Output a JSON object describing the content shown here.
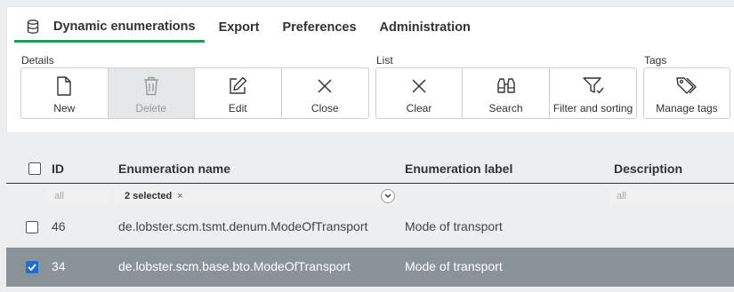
{
  "tabs": [
    {
      "label": "Dynamic enumerations",
      "active": true,
      "icon": "database-icon"
    },
    {
      "label": "Export"
    },
    {
      "label": "Preferences"
    },
    {
      "label": "Administration"
    }
  ],
  "toolbar": {
    "details": {
      "label": "Details",
      "buttons": [
        {
          "label": "New",
          "icon": "file-icon"
        },
        {
          "label": "Delete",
          "icon": "trash-icon",
          "disabled": true
        },
        {
          "label": "Edit",
          "icon": "edit-icon"
        },
        {
          "label": "Close",
          "icon": "close-icon"
        }
      ]
    },
    "list": {
      "label": "List",
      "buttons": [
        {
          "label": "Clear",
          "icon": "close-icon"
        },
        {
          "label": "Search",
          "icon": "binoculars-icon"
        },
        {
          "label": "Filter and sorting",
          "icon": "filter-icon"
        }
      ]
    },
    "tags": {
      "label": "Tags",
      "buttons": [
        {
          "label": "Manage tags",
          "icon": "tags-icon"
        }
      ]
    }
  },
  "table": {
    "columns": [
      "ID",
      "Enumeration name",
      "Enumeration label",
      "Description"
    ],
    "filters": {
      "id_placeholder": "all",
      "name_chip": "2 selected",
      "name_chip_remove": "×",
      "description_placeholder": "all"
    },
    "rows": [
      {
        "id": "46",
        "name": "de.lobster.scm.tsmt.denum.ModeOfTransport",
        "label": "Mode of transport",
        "description": "",
        "selected": false
      },
      {
        "id": "34",
        "name": "de.lobster.scm.base.bto.ModeOfTransport",
        "label": "Mode of transport",
        "description": "",
        "selected": true
      }
    ]
  },
  "colors": {
    "accent": "#1e9b57",
    "selected_row": "#8a9498",
    "checkbox": "#1d6fd6"
  }
}
